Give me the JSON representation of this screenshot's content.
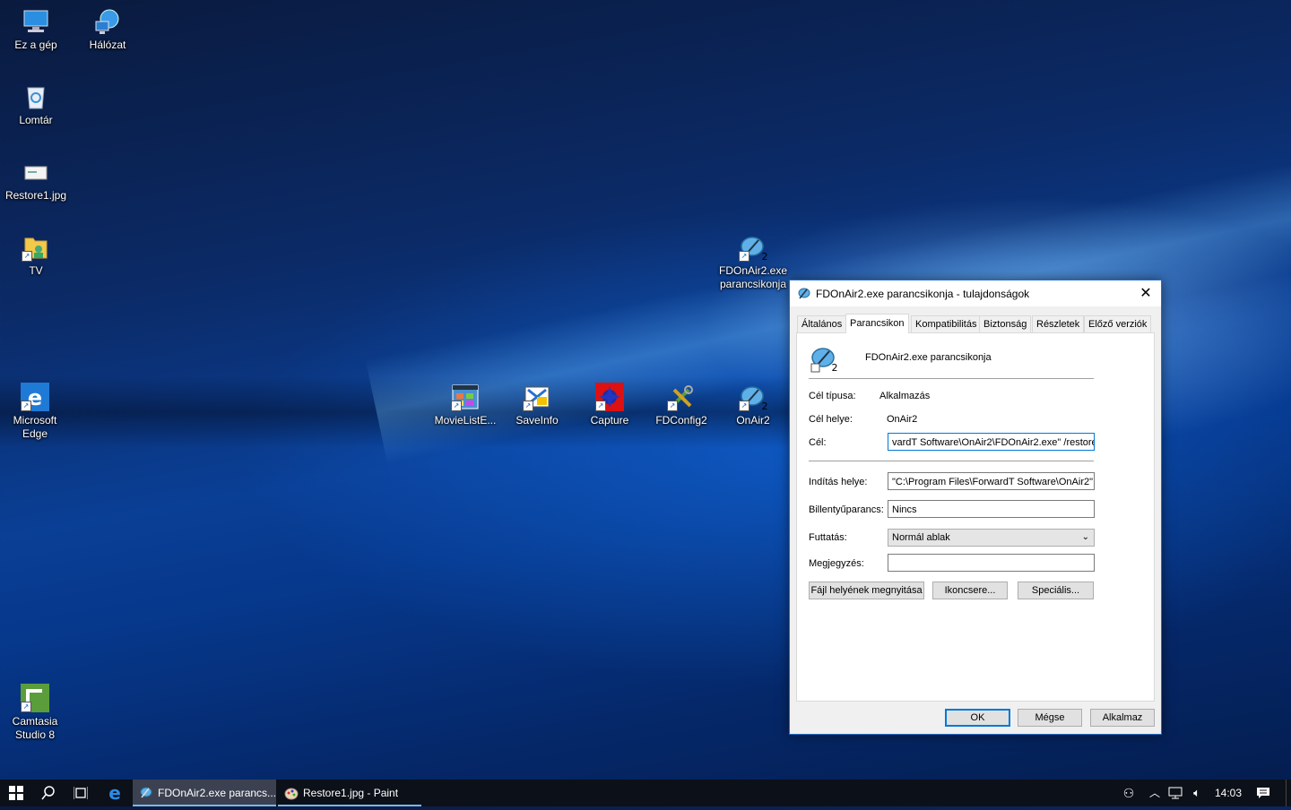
{
  "desktop_icons": [
    {
      "label": "Ez a gép",
      "icon": "computer-icon"
    },
    {
      "label": "Hálózat",
      "icon": "network-icon"
    },
    {
      "label": "Lomtár",
      "icon": "recycle-bin-icon"
    },
    {
      "label": "Restore1.jpg",
      "icon": "image-file-icon"
    },
    {
      "label": "TV",
      "icon": "folder-user-icon"
    },
    {
      "label": "Microsoft Edge",
      "icon": "edge-icon"
    },
    {
      "label": "Camtasia Studio 8",
      "icon": "camtasia-icon"
    },
    {
      "label": "FDOnAir2.exe parancsikonja",
      "icon": "satellite-dish-icon"
    },
    {
      "label": "MovieListE...",
      "icon": "movie-list-icon"
    },
    {
      "label": "SaveInfo",
      "icon": "saveinfo-icon"
    },
    {
      "label": "Capture",
      "icon": "capture-icon"
    },
    {
      "label": "FDConfig2",
      "icon": "tools-icon"
    },
    {
      "label": "OnAir2",
      "icon": "satellite-dish-icon"
    }
  ],
  "dialog": {
    "title": "FDOnAir2.exe parancsikonja - tulajdonságok",
    "tabs": [
      "Általános",
      "Parancsikon",
      "Kompatibilitás",
      "Biztonság",
      "Részletek",
      "Előző verziók"
    ],
    "active_tab": "Parancsikon",
    "shortcut_name": "FDOnAir2.exe parancsikonja",
    "target_type_label": "Cél típusa:",
    "target_type_value": "Alkalmazás",
    "target_location_label": "Cél helye:",
    "target_location_value": "OnAir2",
    "target_label": "Cél:",
    "target_value": "vardT Software\\OnAir2\\FDOnAir2.exe\" /restore",
    "start_in_label": "Indítás helye:",
    "start_in_value": "\"C:\\Program Files\\ForwardT Software\\OnAir2\"",
    "hotkey_label": "Billentyűparancs:",
    "hotkey_value": "Nincs",
    "run_label": "Futtatás:",
    "run_value": "Normál ablak",
    "comment_label": "Megjegyzés:",
    "comment_value": "",
    "open_location_button": "Fájl helyének megnyitása",
    "change_icon_button": "Ikoncsere...",
    "advanced_button": "Speciális...",
    "ok_button": "OK",
    "cancel_button": "Mégse",
    "apply_button": "Alkalmaz"
  },
  "taskbar": {
    "apps": [
      {
        "label": "FDOnAir2.exe parancs...",
        "state": "active"
      },
      {
        "label": "Restore1.jpg - Paint",
        "state": "open"
      }
    ],
    "clock": "14:03"
  },
  "colors": {
    "accent": "#0078d7",
    "taskbar": "#0c1018",
    "dialog_bg": "#f0f0f0"
  }
}
